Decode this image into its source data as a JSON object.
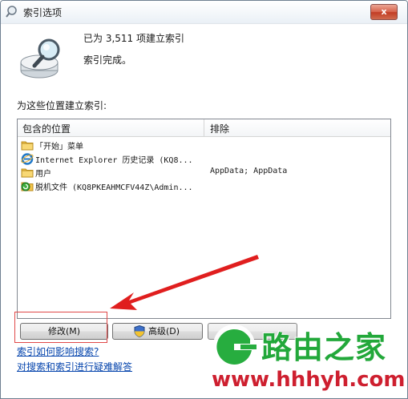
{
  "window": {
    "title": "索引选项",
    "close_label": "x"
  },
  "status": {
    "count_text": "已为 3,511 项建立索引",
    "done_text": "索引完成。"
  },
  "section_label": "为这些位置建立索引:",
  "table": {
    "headers": [
      "包含的位置",
      "排除"
    ],
    "rows": [
      {
        "icon": "folder-icon",
        "name": "「开始」菜单",
        "exclude": ""
      },
      {
        "icon": "internet-explorer-icon",
        "name": "Internet Explorer 历史记录 (KQ8...",
        "exclude": ""
      },
      {
        "icon": "folder-icon",
        "name": "用户",
        "exclude": "AppData; AppData"
      },
      {
        "icon": "offline-files-icon",
        "name": "脱机文件 (KQ8PKEAHMCFV44Z\\Admin...",
        "exclude": ""
      }
    ]
  },
  "buttons": {
    "modify": "修改(M)",
    "advanced": "高级(D)",
    "partial": ""
  },
  "links": {
    "how_index_affects_search": "索引如何影响搜索?",
    "troubleshoot": "对搜索和索引进行疑难解答"
  },
  "watermark": {
    "title": "路由之家",
    "url": "www.hhhyh.com"
  },
  "colors": {
    "accent_annotation": "#e04848",
    "watermark_green": "#22a83a",
    "watermark_red": "#ce1f2f",
    "link": "#0645ad"
  }
}
